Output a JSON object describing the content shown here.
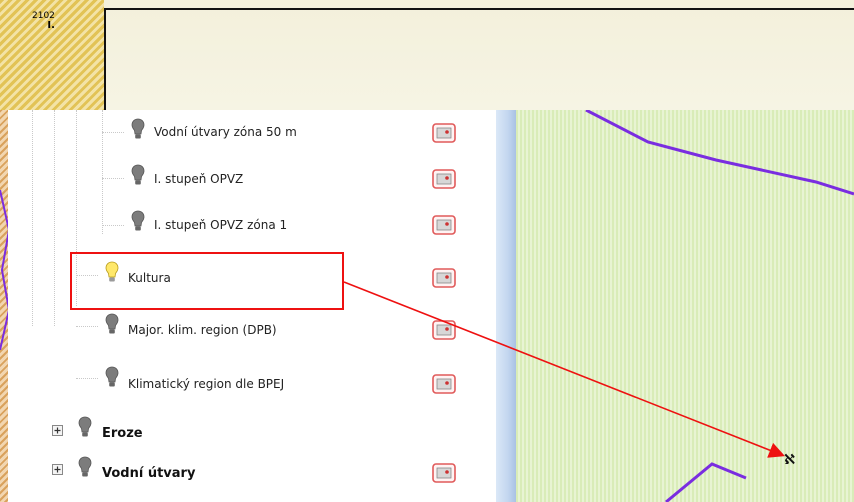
{
  "parcel": {
    "number": "2102",
    "sub": "I."
  },
  "layers": [
    {
      "label": "Vodní útvary zóna 50 m",
      "bulb": "gray-bulb-icon",
      "has_tool": true
    },
    {
      "label": "I. stupeň OPVZ",
      "bulb": "gray-bulb-icon",
      "has_tool": true
    },
    {
      "label": "I. stupeň OPVZ zóna 1",
      "bulb": "gray-bulb-icon",
      "has_tool": true
    },
    {
      "label": "Kultura",
      "bulb": "yellow-bulb-icon",
      "has_tool": true,
      "highlighted": true
    },
    {
      "label": "Major. klim. region (DPB)",
      "bulb": "gray-bulb-icon",
      "has_tool": true
    },
    {
      "label": "Klimatický region dle BPEJ",
      "bulb": "gray-bulb-icon",
      "has_tool": true
    }
  ],
  "groups": [
    {
      "label": "Eroze",
      "bulb": "gray-bulb-icon",
      "has_tool": false
    },
    {
      "label": "Vodní útvary",
      "bulb": "gray-bulb-icon",
      "has_tool": true
    }
  ],
  "colors": {
    "highlight": "#e11111",
    "boundary": "#7a2de0",
    "map_fill": "#e8f4d3",
    "bulb_on": "#ffe86a",
    "bulb_off": "#7c7c7c"
  }
}
